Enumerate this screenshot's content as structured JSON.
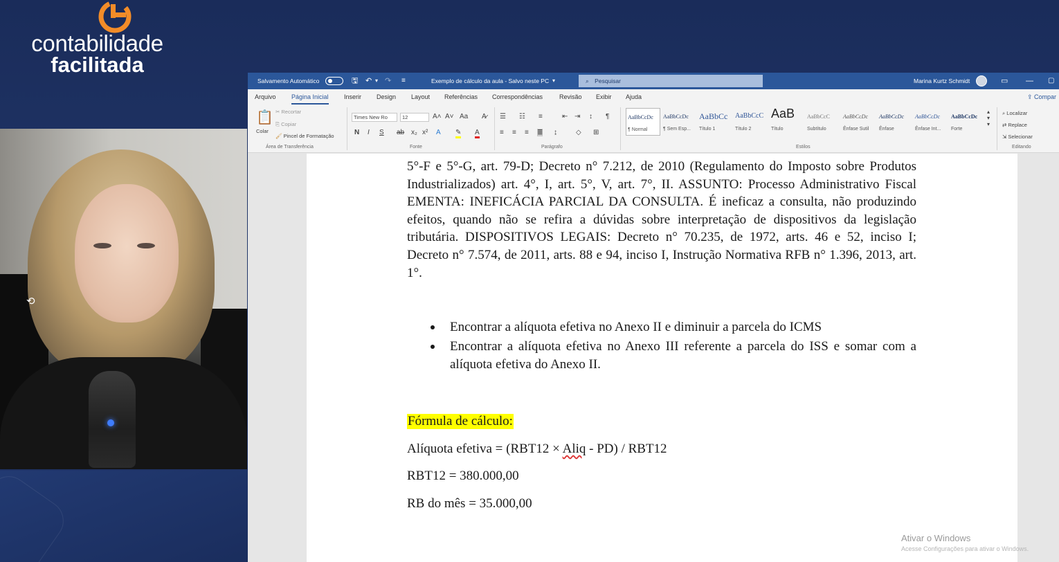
{
  "brand": {
    "line1": "contabilidade",
    "line2": "facilitada",
    "accent": "#f28c28"
  },
  "word": {
    "titlebar": {
      "autosave_label": "Salvamento Automático",
      "doc_title": "Exemplo de cálculo da aula - Salvo neste PC",
      "search_placeholder": "Pesquisar",
      "user_name": "Marina Kurtz Schmidt"
    },
    "tabs": [
      "Arquivo",
      "Página Inicial",
      "Inserir",
      "Design",
      "Layout",
      "Referências",
      "Correspondências",
      "Revisão",
      "Exibir",
      "Ajuda"
    ],
    "share_label": "Compar",
    "ribbon": {
      "clipboard": {
        "paste": "Colar",
        "cut": "Recortar",
        "copy": "Copiar",
        "format_painter": "Pincel de Formatação",
        "group": "Área de Transferência"
      },
      "font": {
        "family": "Times New Ro",
        "size": "12",
        "group": "Fonte"
      },
      "paragraph_group": "Parágrafo",
      "styles": [
        {
          "preview": "AaBbCcDc",
          "name": "¶ Normal"
        },
        {
          "preview": "AaBbCcDc",
          "name": "¶ Sem Esp..."
        },
        {
          "preview": "AaBbCc",
          "name": "Título 1"
        },
        {
          "preview": "AaBbCcC",
          "name": "Título 2"
        },
        {
          "preview": "AaB",
          "name": "Título"
        },
        {
          "preview": "AaBbCcC",
          "name": "Subtítulo"
        },
        {
          "preview": "AaBbCcDc",
          "name": "Ênfase Sutil"
        },
        {
          "preview": "AaBbCcDc",
          "name": "Ênfase"
        },
        {
          "preview": "AaBbCcDc",
          "name": "Ênfase Int..."
        },
        {
          "preview": "AaBbCcDc",
          "name": "Forte"
        }
      ],
      "styles_group": "Estilos",
      "editing": {
        "find": "Localizar",
        "replace": "Replace",
        "select": "Selecionar",
        "group": "Editando"
      }
    }
  },
  "document": {
    "paragraph": "5°-F e 5°-G, art. 79-D; Decreto n° 7.212, de 2010 (Regulamento do Imposto sobre Produtos Industrializados) art. 4°, I, art. 5°, V, art. 7°, II. ASSUNTO: Processo Administrativo Fiscal EMENTA: INEFICÁCIA PARCIAL DA CONSULTA. É ineficaz a consulta, não produzindo efeitos, quando não se refira a dúvidas sobre interpretação de dispositivos da legislação tributária. DISPOSITIVOS LEGAIS: Decreto n° 70.235, de 1972, arts. 46 e 52, inciso I; Decreto n° 7.574, de 2011, arts. 88 e 94, inciso I, Instrução Normativa RFB n° 1.396, 2013, art. 1°.",
    "bullets": [
      "Encontrar a alíquota efetiva no Anexo II e diminuir a parcela do ICMS",
      "Encontrar a alíquota efetiva no Anexo III referente a parcela do ISS e somar com a alíquota efetiva do Anexo II."
    ],
    "formula_title": "Fórmula de cálculo:",
    "formula_prefix": "Alíquota efetiva = (RBT12 × ",
    "formula_aliq": "Aliq",
    "formula_suffix": " - PD) / RBT12",
    "rbt12": "RBT12 = 380.000,00",
    "rb_mes": "RB do mês = 35.000,00"
  },
  "watermark": {
    "title": "Ativar o Windows",
    "subtitle": "Acesse Configurações para ativar o Windows."
  }
}
